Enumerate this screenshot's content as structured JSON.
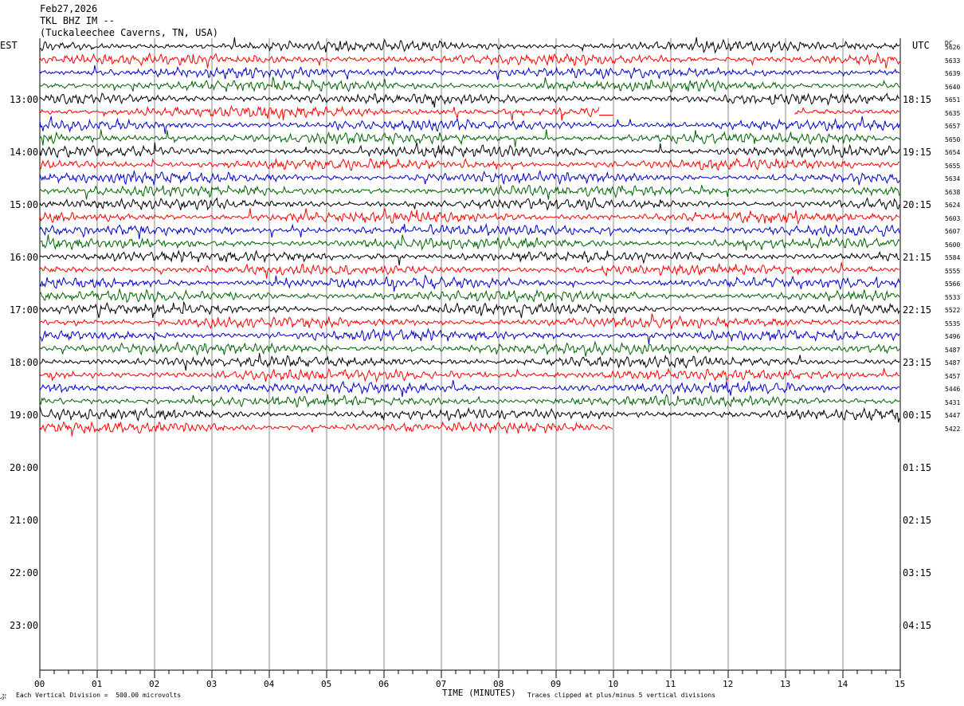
{
  "header": {
    "date": "Feb27,2026",
    "station": "TKL BHZ IM --",
    "location": "(Tuckaleechee Caverns, TN, USA)"
  },
  "left_zone": "EST",
  "right_zone": "UTC",
  "dc_label": "DC",
  "footer": {
    "scale_note": "Each Vertical Division =  500.00 microvolts",
    "xlabel": "TIME (MINUTES)",
    "clip_note": "Traces clipped at plus/minus 5 vertical divisions"
  },
  "colors": {
    "trace_cycle": [
      "#000000",
      "#ff0000",
      "#0000cc",
      "#006400"
    ],
    "grid": "#888888"
  },
  "chart_data": {
    "type": "line",
    "title": "TKL BHZ IM --",
    "xlabel": "TIME (MINUTES)",
    "xlim": [
      0,
      15
    ],
    "x_ticks": [
      "00",
      "01",
      "02",
      "03",
      "04",
      "05",
      "06",
      "07",
      "08",
      "09",
      "10",
      "11",
      "12",
      "13",
      "14",
      "15"
    ],
    "left_hour_labels": [
      "13:00",
      "14:00",
      "15:00",
      "16:00",
      "17:00",
      "18:00",
      "19:00",
      "20:00",
      "21:00",
      "22:00",
      "23:00"
    ],
    "right_hour_labels": [
      "18:15",
      "19:15",
      "20:15",
      "21:15",
      "22:15",
      "23:15",
      "00:15",
      "01:15",
      "02:15",
      "03:15",
      "04:15"
    ],
    "rows_per_hour": 4,
    "minutes_per_row": 15,
    "total_row_slots": 36,
    "first_row_index_in_hour": 0,
    "dc_offsets": [
      5626,
      5633,
      5639,
      5640,
      5651,
      5635,
      5657,
      5650,
      5654,
      5655,
      5634,
      5638,
      5624,
      5603,
      5607,
      5600,
      5584,
      5555,
      5566,
      5533,
      5522,
      5535,
      5496,
      5487,
      5487,
      5457,
      5446,
      5431,
      5447,
      5422
    ],
    "trace_end_minute": [
      15,
      15,
      15,
      15,
      15,
      15,
      15,
      15,
      15,
      15,
      15,
      15,
      15,
      15,
      15,
      15,
      15,
      15,
      15,
      15,
      15,
      15,
      15,
      15,
      15,
      15,
      15,
      15,
      15,
      10
    ],
    "data_gaps": [
      {
        "row": 5,
        "from_minute": 9.75,
        "to_minute": 13.15
      }
    ],
    "vertical_division_microvolts": 500.0,
    "clip_divisions": 5
  }
}
